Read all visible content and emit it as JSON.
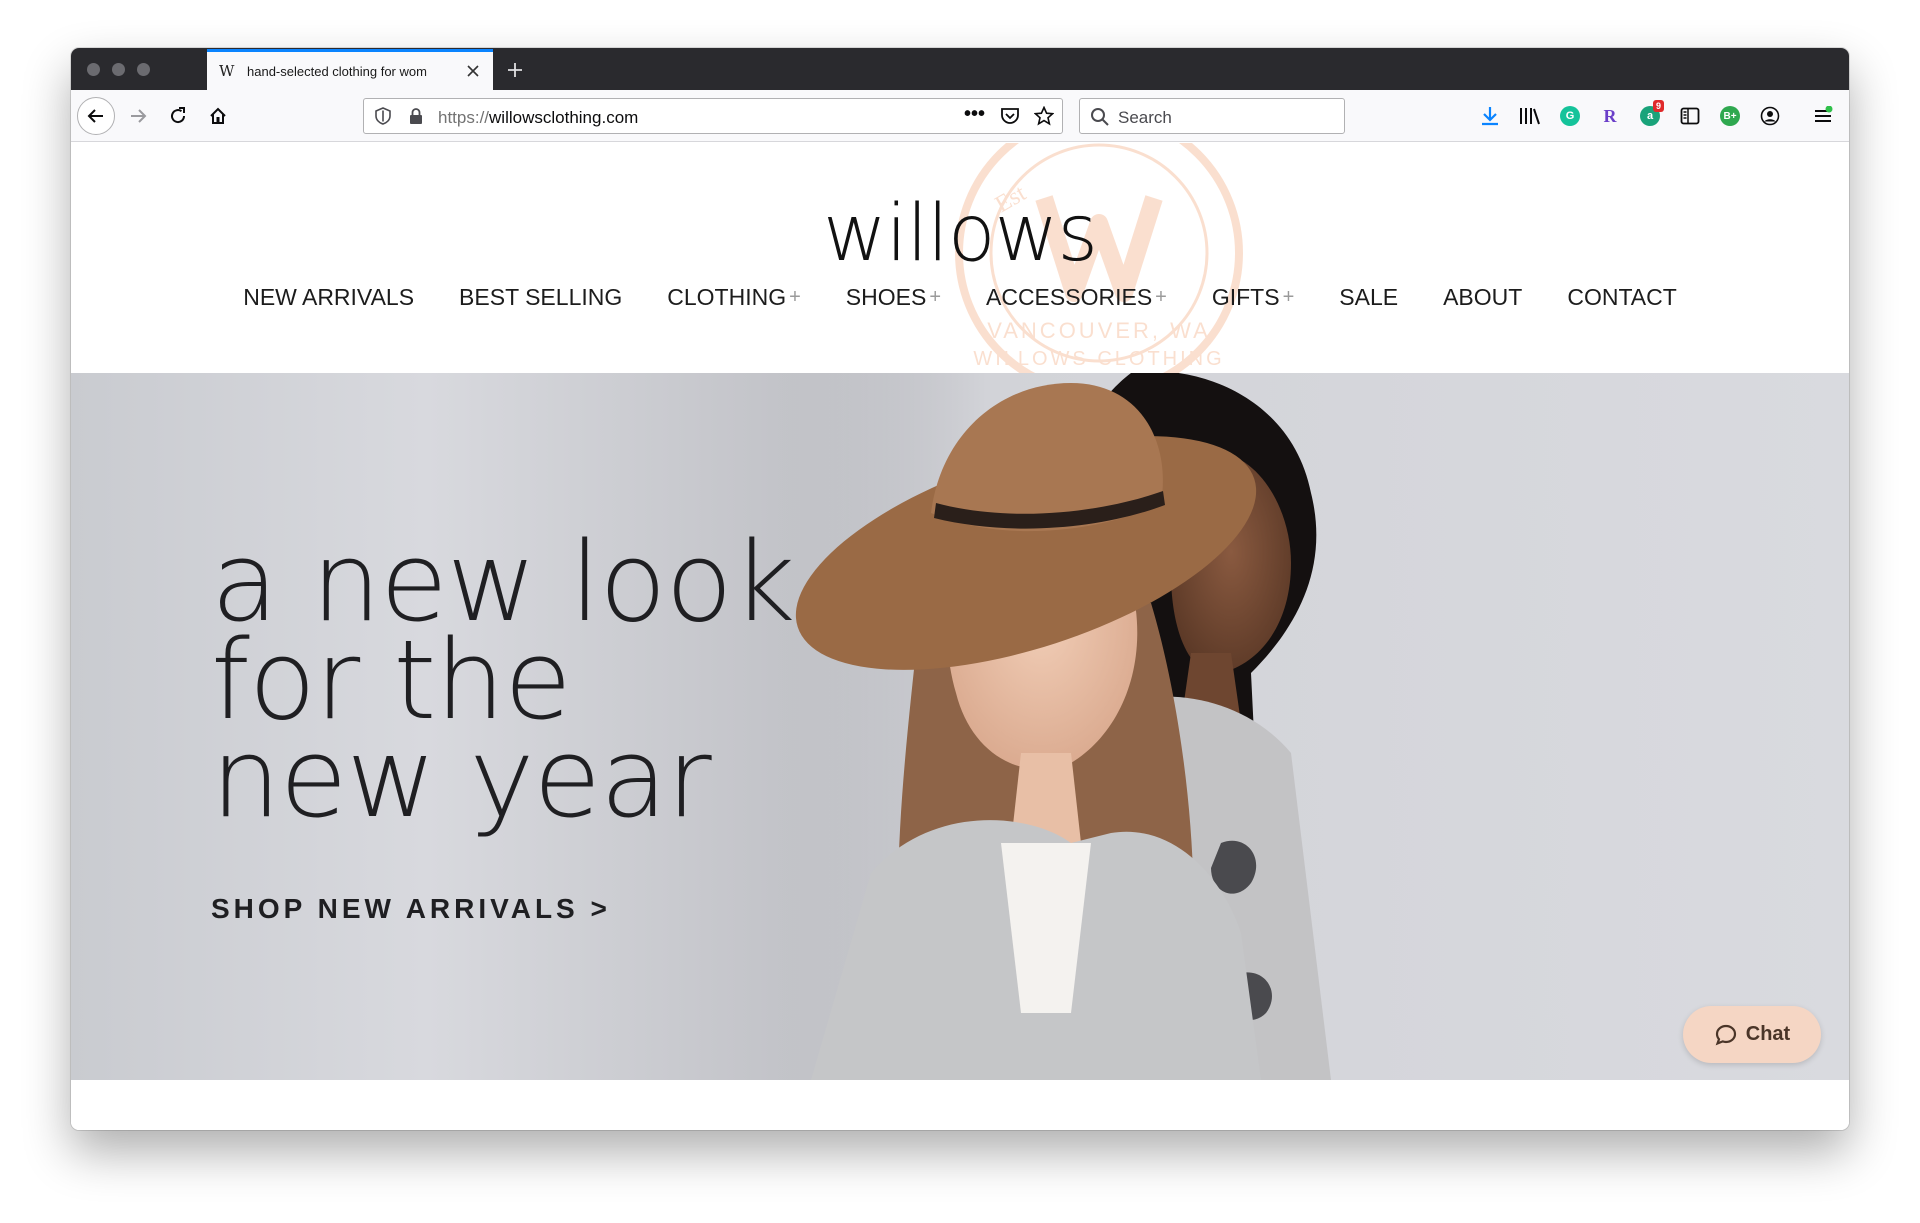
{
  "browser": {
    "tab_title": "hand-selected clothing for wom",
    "tab_favicon": "W",
    "url_scheme": "https://",
    "url_host": "willowsclothing.com",
    "search_placeholder": "Search",
    "page_actions_icon": "•••",
    "extension_badge": "9",
    "icons": [
      "back-icon",
      "forward-icon",
      "reload-icon",
      "home-icon",
      "shield-icon",
      "lock-icon",
      "pocket-icon",
      "star-icon",
      "download-icon",
      "library-icon",
      "grammarly-icon",
      "r-extension-icon",
      "badge-extension-icon",
      "reader-sidebar-icon",
      "b-plus-extension-icon",
      "account-icon",
      "menu-icon"
    ]
  },
  "site": {
    "logo": "willows",
    "nav": [
      {
        "label": "NEW ARRIVALS",
        "has_submenu": false
      },
      {
        "label": "BEST SELLING",
        "has_submenu": false
      },
      {
        "label": "CLOTHING",
        "has_submenu": true
      },
      {
        "label": "SHOES",
        "has_submenu": true
      },
      {
        "label": "ACCESSORIES",
        "has_submenu": true
      },
      {
        "label": "GIFTS",
        "has_submenu": true
      },
      {
        "label": "SALE",
        "has_submenu": false
      },
      {
        "label": "ABOUT",
        "has_submenu": false
      },
      {
        "label": "CONTACT",
        "has_submenu": false
      }
    ],
    "submenu_marker": "+",
    "stamp_text": "Est. VANCOUVER, WA  WILLOWS CLOTHING",
    "hero": {
      "line1": "a new look",
      "line2": "for the",
      "line3": "new year",
      "cta": "SHOP NEW ARRIVALS >"
    },
    "chat_label": "Chat"
  },
  "colors": {
    "accent_tab": "#0a84ff",
    "chat_bg": "#f5d6c4",
    "stamp": "#f2a678"
  }
}
